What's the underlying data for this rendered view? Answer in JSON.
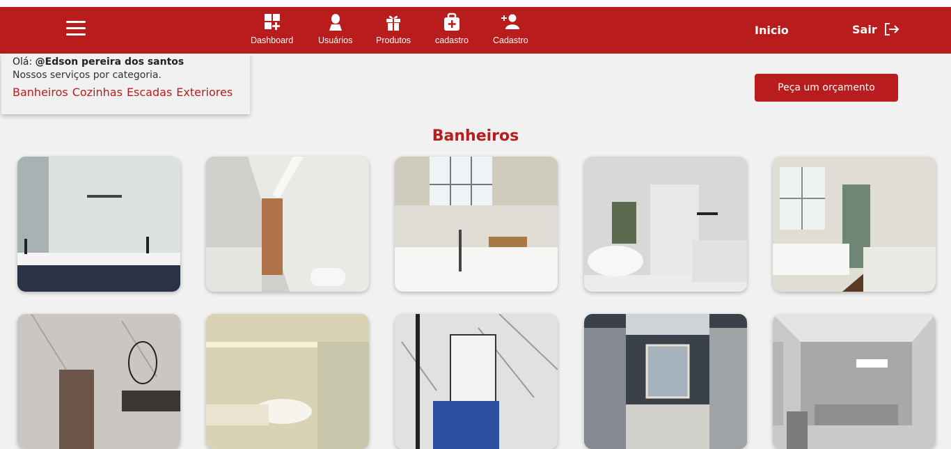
{
  "navbar": {
    "items": [
      {
        "label": "Dashboard",
        "icon": "dashboard-icon"
      },
      {
        "label": "Usuários",
        "icon": "user-icon"
      },
      {
        "label": "Produtos",
        "icon": "gift-icon"
      },
      {
        "label": "cadastro",
        "icon": "briefcase-plus-icon"
      },
      {
        "label": "Cadastro",
        "icon": "user-plus-icon"
      }
    ],
    "inicio": "Inicio",
    "sair": "Sair"
  },
  "info": {
    "greeting_prefix": "Olá:",
    "username": "@Edson pereira dos santos",
    "subtitle": "Nossos serviços por categoria.",
    "categories": [
      "Banheiros",
      "Cozinhas",
      "Escadas",
      "Exteriores"
    ]
  },
  "quote_button": "Peça um orçamento",
  "section_title": "Banheiros",
  "colors": {
    "brand": "#b91c1c",
    "background": "#f1f1f1"
  },
  "gallery": {
    "rows": [
      [
        "bathroom-photo-1",
        "bathroom-photo-2",
        "bathroom-photo-3",
        "bathroom-photo-4",
        "bathroom-photo-5"
      ],
      [
        "bathroom-photo-6",
        "bathroom-photo-7",
        "bathroom-photo-8",
        "bathroom-photo-9",
        "bathroom-photo-10"
      ]
    ]
  }
}
